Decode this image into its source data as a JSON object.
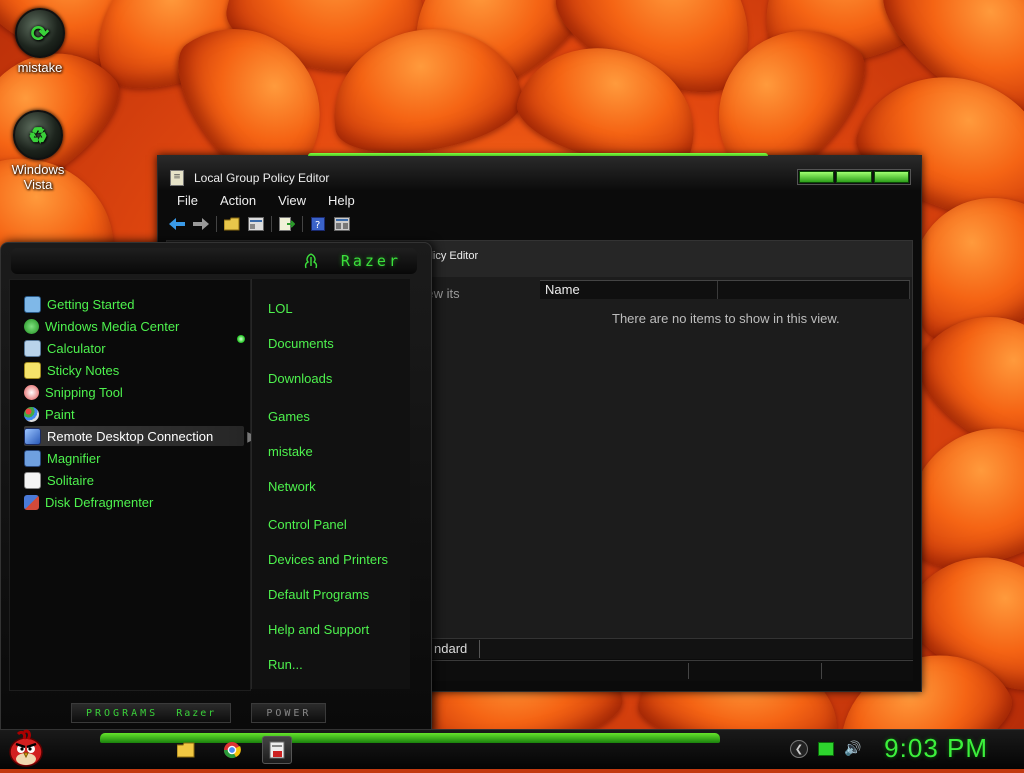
{
  "desktop": {
    "icons": [
      {
        "label": "mistake",
        "icon": "app-orb-icon"
      },
      {
        "label": "Windows Vista",
        "icon": "recycle-bin-icon"
      }
    ]
  },
  "window": {
    "title": "Local Group Policy Editor",
    "menu": [
      "File",
      "Action",
      "View",
      "Help"
    ],
    "toolbar": [
      "back-icon",
      "forward-icon",
      "folder-icon",
      "properties-icon",
      "export-icon",
      "help-icon",
      "view-icon"
    ],
    "content": {
      "header_title": "Policy Editor",
      "side_text": "view its",
      "columns": [
        "Name",
        ""
      ],
      "empty_message": "There are no items to show in this view.",
      "tab": "ndard"
    }
  },
  "start_menu": {
    "brand": "Razer",
    "programs": [
      {
        "label": "Getting Started",
        "icon": "getting-started-icon",
        "color": "#7fb8e8"
      },
      {
        "label": "Windows Media Center",
        "icon": "media-center-icon",
        "color": "#3cb43c"
      },
      {
        "label": "Calculator",
        "icon": "calculator-icon",
        "color": "#b9d3ea"
      },
      {
        "label": "Sticky Notes",
        "icon": "sticky-notes-icon",
        "color": "#f5e36a"
      },
      {
        "label": "Snipping Tool",
        "icon": "snipping-tool-icon",
        "color": "#e05050"
      },
      {
        "label": "Paint",
        "icon": "paint-icon",
        "color": "#dddddd"
      },
      {
        "label": "Remote Desktop Connection",
        "icon": "remote-desktop-icon",
        "color": "#5b8fd8",
        "selected": true
      },
      {
        "label": "Magnifier",
        "icon": "magnifier-icon",
        "color": "#6fa0e0"
      },
      {
        "label": "Solitaire",
        "icon": "solitaire-icon",
        "color": "#f4f4f4"
      },
      {
        "label": "Disk Defragmenter",
        "icon": "defragmenter-icon",
        "color": "#d24a3a"
      }
    ],
    "places": [
      "LOL",
      "Documents",
      "Downloads",
      "Games",
      "mistake",
      "Network",
      "Control Panel",
      "Devices and Printers",
      "Default Programs",
      "Help and Support",
      "Run..."
    ],
    "bottom": {
      "programs": "PROGRAMS",
      "programs_brand": "Razer",
      "power": "POWER"
    }
  },
  "taskbar": {
    "apps": [
      {
        "icon": "explorer-icon",
        "active": false
      },
      {
        "icon": "chrome-icon",
        "active": false
      },
      {
        "icon": "group-policy-icon",
        "active": true
      }
    ],
    "tray": [
      "show-hidden-icon",
      "network-icon",
      "volume-icon"
    ],
    "clock": "9:03 PM"
  },
  "colors": {
    "accent": "#3cf03c",
    "window_bg": "#0b0b0b",
    "wallpaper": "#e54a10"
  }
}
